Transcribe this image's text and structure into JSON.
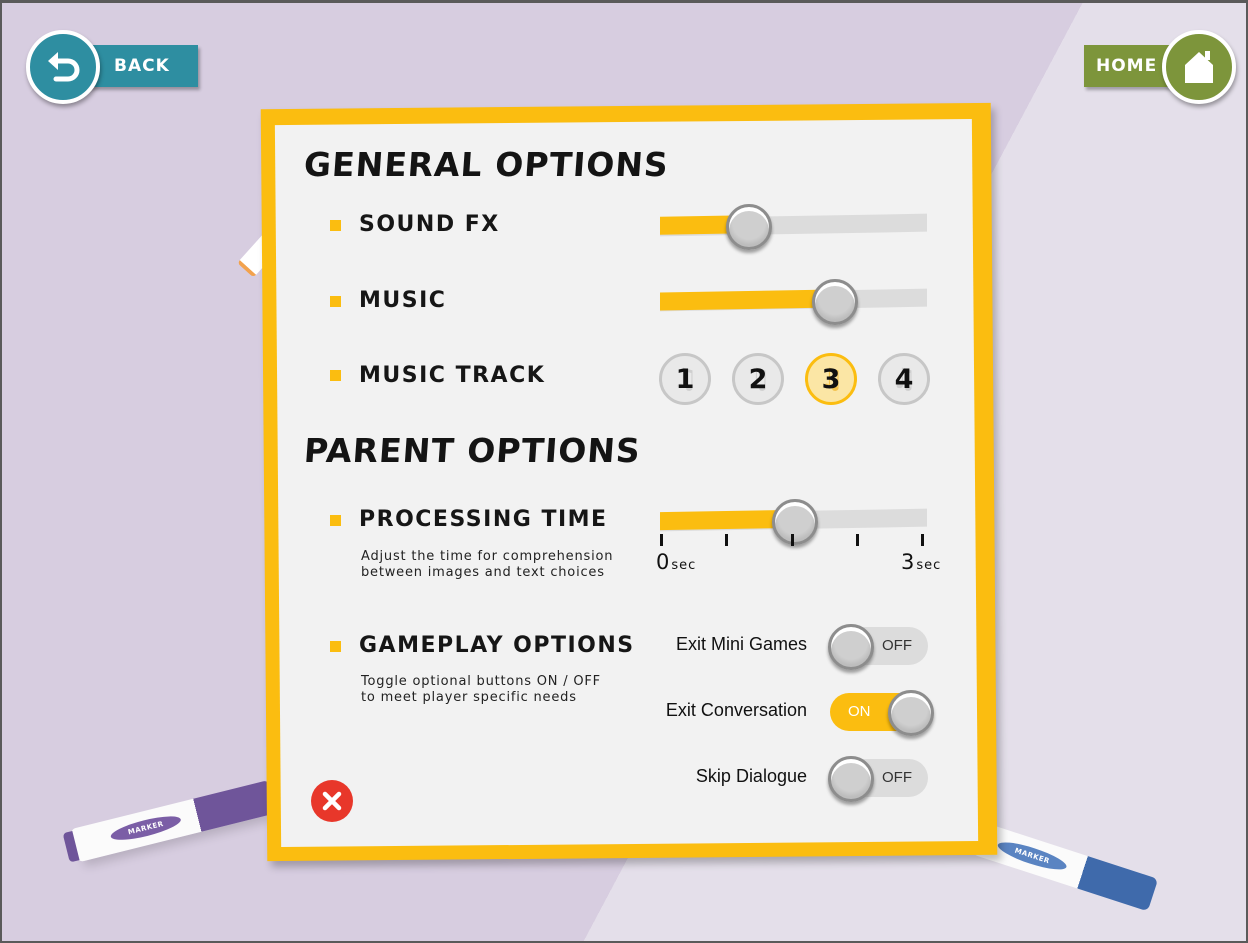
{
  "nav": {
    "back_label": "BACK",
    "home_label": "HOME"
  },
  "general": {
    "title": "GENERAL OPTIONS",
    "sound_fx": {
      "label": "SOUND FX",
      "level": 0.33
    },
    "music": {
      "label": "MUSIC",
      "level": 0.65
    },
    "music_track": {
      "label": "MUSIC TRACK",
      "options": [
        "1",
        "2",
        "3",
        "4"
      ],
      "selected": "3"
    }
  },
  "parent": {
    "title": "PARENT OPTIONS",
    "processing_time": {
      "label": "PROCESSING TIME",
      "description_line1": "Adjust the time for comprehension",
      "description_line2": "between images and text choices",
      "value_sec": 1.5,
      "min_label": "0",
      "max_label": "3",
      "unit": "sec"
    },
    "gameplay": {
      "label": "GAMEPLAY OPTIONS",
      "description_line1": "Toggle optional buttons ON / OFF",
      "description_line2": "to meet player specific needs",
      "toggles": [
        {
          "label": "Exit Mini Games",
          "state": "OFF"
        },
        {
          "label": "Exit Conversation",
          "state": "ON"
        },
        {
          "label": "Skip Dialogue",
          "state": "OFF"
        }
      ]
    }
  },
  "decor": {
    "marker_label": "MARKER"
  },
  "colors": {
    "accent": "#fbbd10",
    "back": "#2e8ea1",
    "home": "#7d953b",
    "close": "#e8372a"
  }
}
